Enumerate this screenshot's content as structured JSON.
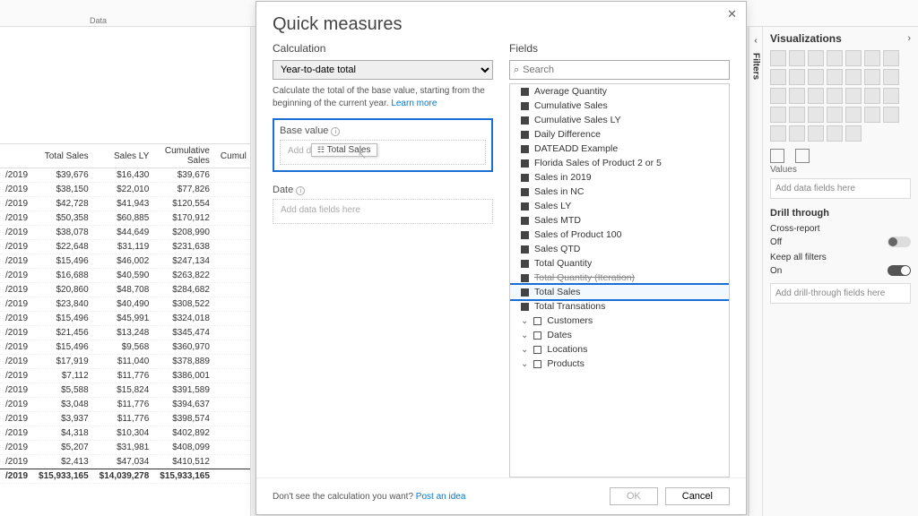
{
  "ribbon": {
    "data_label": "Data"
  },
  "table": {
    "headers": [
      "",
      "Total Sales",
      "Sales LY",
      "Cumulative Sales",
      "Cumul"
    ],
    "rows": [
      [
        "/2019",
        "$39,676",
        "$16,430",
        "$39,676",
        ""
      ],
      [
        "/2019",
        "$38,150",
        "$22,010",
        "$77,826",
        ""
      ],
      [
        "/2019",
        "$42,728",
        "$41,943",
        "$120,554",
        ""
      ],
      [
        "/2019",
        "$50,358",
        "$60,885",
        "$170,912",
        ""
      ],
      [
        "/2019",
        "$38,078",
        "$44,649",
        "$208,990",
        ""
      ],
      [
        "/2019",
        "$22,648",
        "$31,119",
        "$231,638",
        ""
      ],
      [
        "/2019",
        "$15,496",
        "$46,002",
        "$247,134",
        ""
      ],
      [
        "/2019",
        "$16,688",
        "$40,590",
        "$263,822",
        ""
      ],
      [
        "/2019",
        "$20,860",
        "$48,708",
        "$284,682",
        ""
      ],
      [
        "/2019",
        "$23,840",
        "$40,490",
        "$308,522",
        ""
      ],
      [
        "/2019",
        "$15,496",
        "$45,991",
        "$324,018",
        ""
      ],
      [
        "/2019",
        "$21,456",
        "$13,248",
        "$345,474",
        ""
      ],
      [
        "/2019",
        "$15,496",
        "$9,568",
        "$360,970",
        ""
      ],
      [
        "/2019",
        "$17,919",
        "$11,040",
        "$378,889",
        ""
      ],
      [
        "/2019",
        "$7,112",
        "$11,776",
        "$386,001",
        ""
      ],
      [
        "/2019",
        "$5,588",
        "$15,824",
        "$391,589",
        ""
      ],
      [
        "/2019",
        "$3,048",
        "$11,776",
        "$394,637",
        ""
      ],
      [
        "/2019",
        "$3,937",
        "$11,776",
        "$398,574",
        ""
      ],
      [
        "/2019",
        "$4,318",
        "$10,304",
        "$402,892",
        ""
      ],
      [
        "/2019",
        "$5,207",
        "$31,981",
        "$408,099",
        ""
      ],
      [
        "/2019",
        "$2,413",
        "$47,034",
        "$410,512",
        ""
      ]
    ],
    "totals": [
      "/2019",
      "$15,933,165",
      "$14,039,278",
      "$15,933,165",
      ""
    ]
  },
  "dialog": {
    "title": "Quick measures",
    "calc_label": "Calculation",
    "calc_value": "Year-to-date total",
    "help_html_pre": "Calculate the total of the base value, starting from the beginning of the current year. ",
    "help_link": "Learn more",
    "base_value_label": "Base value",
    "date_label": "Date",
    "dz_add_text": "Add d",
    "dz_chip": "Total Sales",
    "dz_empty": "Add data fields here",
    "fields_label": "Fields",
    "search_placeholder": "Search",
    "measures": [
      "Average Quantity",
      "Cumulative Sales",
      "Cumulative Sales LY",
      "Daily Difference",
      "DATEADD Example",
      "Florida Sales of Product 2 or 5",
      "Sales in 2019",
      "Sales in NC",
      "Sales LY",
      "Sales MTD",
      "Sales of Product 100",
      "Sales QTD",
      "Total Quantity"
    ],
    "struck_measure": "Total Quantity (Iteration)",
    "highlight_measure": "Total Sales",
    "after_measure": "Total Transations",
    "tables": [
      "Customers",
      "Dates",
      "Locations",
      "Products"
    ],
    "post_idea_pre": "Don't see the calculation you want? ",
    "post_idea_link": "Post an idea",
    "ok": "OK",
    "cancel": "Cancel"
  },
  "right": {
    "filters": "Filters",
    "vis_title": "Visualizations",
    "values_label": "Values",
    "add_fields": "Add data fields here",
    "drill_title": "Drill through",
    "cross_report": "Cross-report",
    "off": "Off",
    "keep_filters": "Keep all filters",
    "on": "On",
    "add_drill": "Add drill-through fields here"
  }
}
